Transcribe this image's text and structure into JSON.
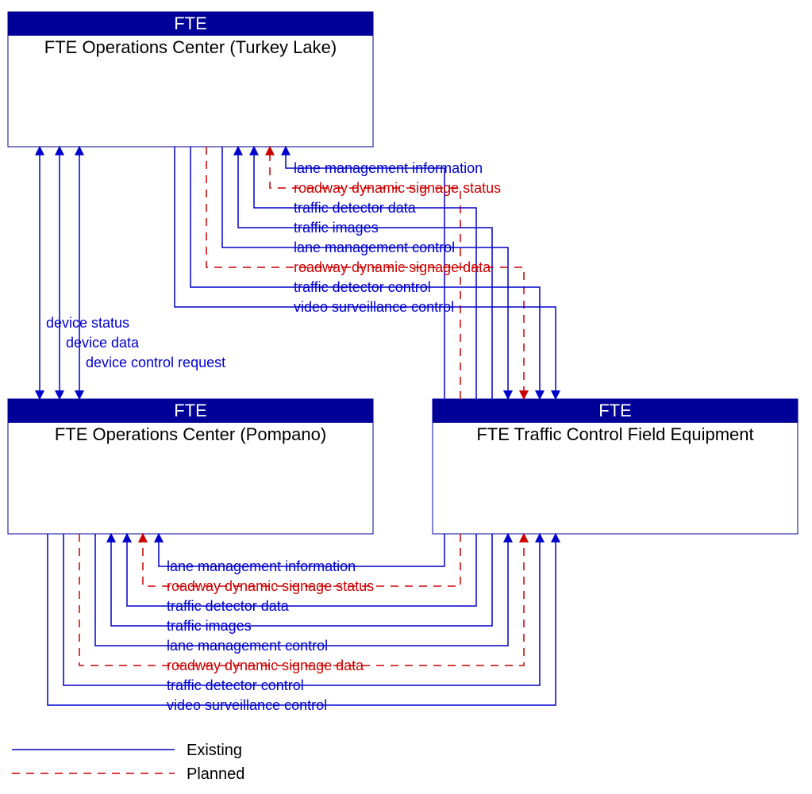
{
  "nodes": {
    "turkey": {
      "header": "FTE",
      "title": "FTE Operations Center (Turkey Lake)"
    },
    "pompano": {
      "header": "FTE",
      "title": "FTE Operations Center (Pompano)"
    },
    "field": {
      "header": "FTE",
      "title": "FTE Traffic Control Field Equipment"
    }
  },
  "flows_turkey_field": [
    {
      "label": "lane management information",
      "status": "existing",
      "dir": "to_turkey"
    },
    {
      "label": "roadway dynamic signage status",
      "status": "planned",
      "dir": "to_turkey"
    },
    {
      "label": "traffic detector data",
      "status": "existing",
      "dir": "to_turkey"
    },
    {
      "label": "traffic images",
      "status": "existing",
      "dir": "to_turkey"
    },
    {
      "label": "lane management control",
      "status": "existing",
      "dir": "to_field"
    },
    {
      "label": "roadway dynamic signage data",
      "status": "planned",
      "dir": "to_field"
    },
    {
      "label": "traffic detector control",
      "status": "existing",
      "dir": "to_field"
    },
    {
      "label": "video surveillance control",
      "status": "existing",
      "dir": "to_field"
    }
  ],
  "flows_turkey_pompano": [
    {
      "label": "device status",
      "status": "existing",
      "dir": "both"
    },
    {
      "label": "device data",
      "status": "existing",
      "dir": "both"
    },
    {
      "label": "device control request",
      "status": "existing",
      "dir": "both"
    }
  ],
  "flows_pompano_field": [
    {
      "label": "lane management information",
      "status": "existing",
      "dir": "to_pompano"
    },
    {
      "label": "roadway dynamic signage status",
      "status": "planned",
      "dir": "to_pompano"
    },
    {
      "label": "traffic detector data",
      "status": "existing",
      "dir": "to_pompano"
    },
    {
      "label": "traffic images",
      "status": "existing",
      "dir": "to_pompano"
    },
    {
      "label": "lane management control",
      "status": "existing",
      "dir": "to_field"
    },
    {
      "label": "roadway dynamic signage data",
      "status": "planned",
      "dir": "to_field"
    },
    {
      "label": "traffic detector control",
      "status": "existing",
      "dir": "to_field"
    },
    {
      "label": "video surveillance control",
      "status": "existing",
      "dir": "to_field"
    }
  ],
  "legend": {
    "existing": "Existing",
    "planned": "Planned"
  }
}
